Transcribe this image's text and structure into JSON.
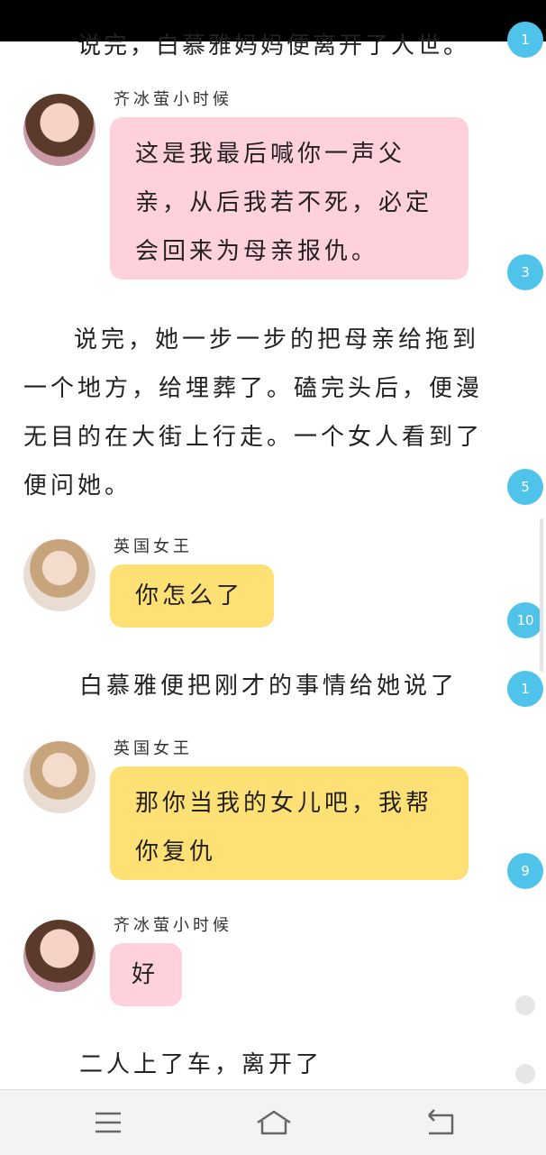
{
  "top_cut_text": "说完，白慕雅妈妈便离开了人世。",
  "messages": [
    {
      "name": "齐冰萤小时候",
      "text": "这是我最后喊你一声父亲，从后我若不死，必定会回来为母亲报仇。"
    },
    {
      "name": "英国女王",
      "text": "你怎么了"
    },
    {
      "name": "英国女王",
      "text": "那你当我的女儿吧，我帮你复仇"
    },
    {
      "name": "齐冰萤小时候",
      "text": "好"
    }
  ],
  "paragraphs": [
    "说完，她一步一步的把母亲给拖到一个地方，给埋葬了。磕完头后，便漫无目的在大街上行走。一个女人看到了便问她。",
    "白慕雅便把刚才的事情给她说了",
    "二人上了车，离开了"
  ],
  "badges": [
    "1",
    "3",
    "5",
    "10",
    "1",
    "9"
  ],
  "colors": {
    "pink_bubble": "#ffd1dc",
    "yellow_bubble": "#ffe074",
    "badge": "#4fc3ea"
  },
  "nav": [
    "menu-icon",
    "home-icon",
    "back-icon"
  ]
}
